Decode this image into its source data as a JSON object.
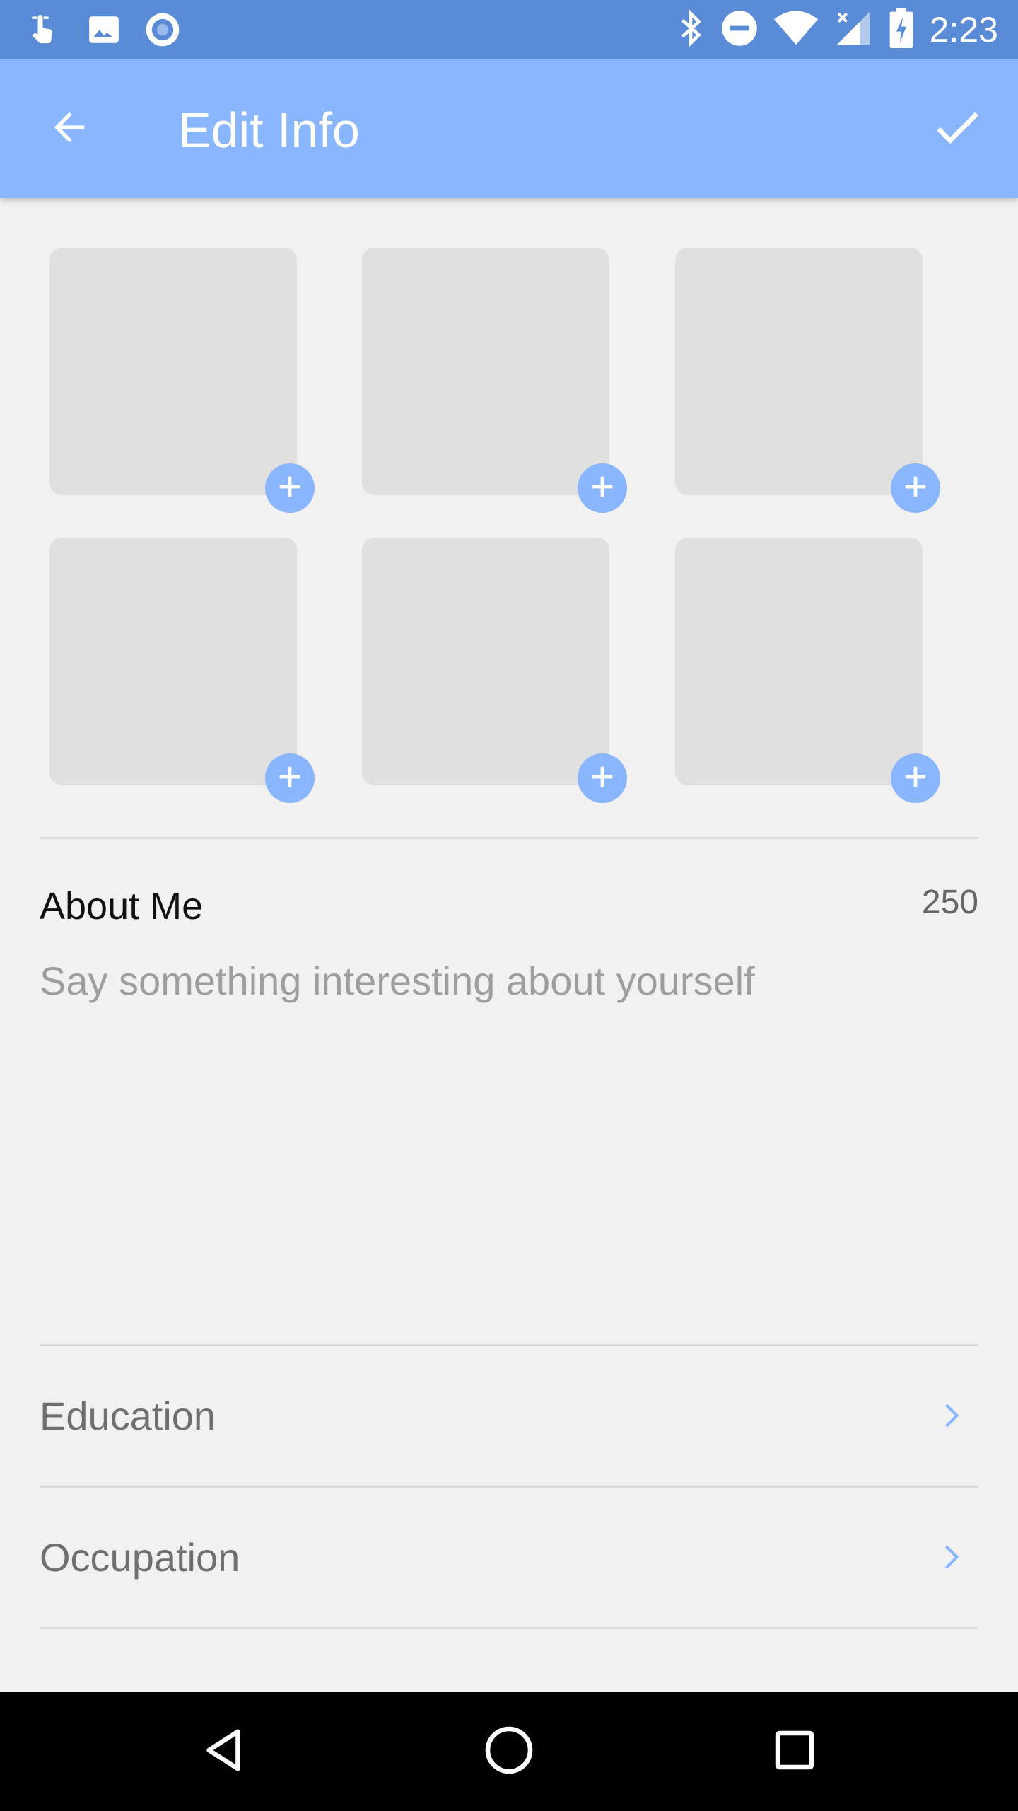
{
  "status_bar": {
    "time": "2:23",
    "icons": [
      "touch-icon",
      "image-icon",
      "record-icon",
      "bluetooth-icon",
      "do-not-disturb-icon",
      "wifi-icon",
      "signal-icon",
      "battery-charging-icon"
    ]
  },
  "app_bar": {
    "title": "Edit Info",
    "back_icon": "arrow-left-icon",
    "confirm_icon": "check-icon",
    "background": "#8ab6fe"
  },
  "photos": {
    "slot_count": 6,
    "add_icon": "plus-circle-icon",
    "accent": "#8ab6fe"
  },
  "about_me": {
    "label": "About Me",
    "char_count": "250",
    "placeholder": "Say something interesting about yourself"
  },
  "rows": [
    {
      "label": "Education",
      "icon": "chevron-right-icon"
    },
    {
      "label": "Occupation",
      "icon": "chevron-right-icon"
    }
  ],
  "nav_bar": {
    "icons": [
      "back-triangle-icon",
      "home-circle-icon",
      "recents-square-icon"
    ]
  }
}
